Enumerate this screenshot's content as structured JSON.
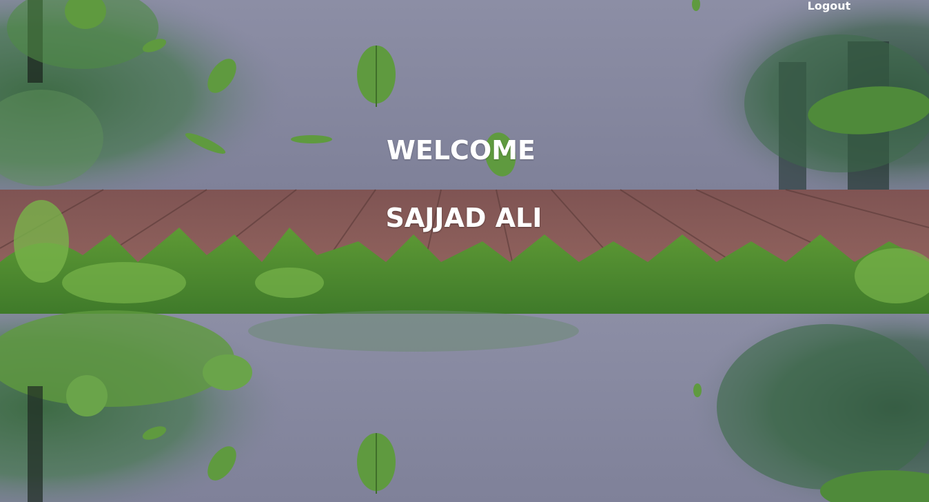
{
  "header": {
    "logout_label": "Logout"
  },
  "hero": {
    "welcome_text": "WELCOME",
    "user_name": "SAJJAD ALI"
  },
  "colors": {
    "overlay_tint": "#7d7f98",
    "wood": "#8a5f5c",
    "grass": "#6fa83a",
    "leaf": "#5f9a3f",
    "text": "#ffffff"
  },
  "icons": {
    "background": "forest-boardwalk-background"
  }
}
